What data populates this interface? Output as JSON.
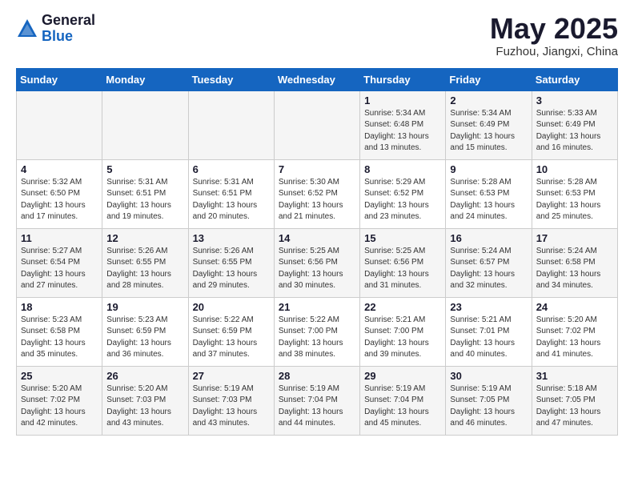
{
  "logo": {
    "general": "General",
    "blue": "Blue"
  },
  "title": {
    "month_year": "May 2025",
    "location": "Fuzhou, Jiangxi, China"
  },
  "weekdays": [
    "Sunday",
    "Monday",
    "Tuesday",
    "Wednesday",
    "Thursday",
    "Friday",
    "Saturday"
  ],
  "weeks": [
    [
      {
        "day": "",
        "info": ""
      },
      {
        "day": "",
        "info": ""
      },
      {
        "day": "",
        "info": ""
      },
      {
        "day": "",
        "info": ""
      },
      {
        "day": "1",
        "info": "Sunrise: 5:34 AM\nSunset: 6:48 PM\nDaylight: 13 hours\nand 13 minutes."
      },
      {
        "day": "2",
        "info": "Sunrise: 5:34 AM\nSunset: 6:49 PM\nDaylight: 13 hours\nand 15 minutes."
      },
      {
        "day": "3",
        "info": "Sunrise: 5:33 AM\nSunset: 6:49 PM\nDaylight: 13 hours\nand 16 minutes."
      }
    ],
    [
      {
        "day": "4",
        "info": "Sunrise: 5:32 AM\nSunset: 6:50 PM\nDaylight: 13 hours\nand 17 minutes."
      },
      {
        "day": "5",
        "info": "Sunrise: 5:31 AM\nSunset: 6:51 PM\nDaylight: 13 hours\nand 19 minutes."
      },
      {
        "day": "6",
        "info": "Sunrise: 5:31 AM\nSunset: 6:51 PM\nDaylight: 13 hours\nand 20 minutes."
      },
      {
        "day": "7",
        "info": "Sunrise: 5:30 AM\nSunset: 6:52 PM\nDaylight: 13 hours\nand 21 minutes."
      },
      {
        "day": "8",
        "info": "Sunrise: 5:29 AM\nSunset: 6:52 PM\nDaylight: 13 hours\nand 23 minutes."
      },
      {
        "day": "9",
        "info": "Sunrise: 5:28 AM\nSunset: 6:53 PM\nDaylight: 13 hours\nand 24 minutes."
      },
      {
        "day": "10",
        "info": "Sunrise: 5:28 AM\nSunset: 6:53 PM\nDaylight: 13 hours\nand 25 minutes."
      }
    ],
    [
      {
        "day": "11",
        "info": "Sunrise: 5:27 AM\nSunset: 6:54 PM\nDaylight: 13 hours\nand 27 minutes."
      },
      {
        "day": "12",
        "info": "Sunrise: 5:26 AM\nSunset: 6:55 PM\nDaylight: 13 hours\nand 28 minutes."
      },
      {
        "day": "13",
        "info": "Sunrise: 5:26 AM\nSunset: 6:55 PM\nDaylight: 13 hours\nand 29 minutes."
      },
      {
        "day": "14",
        "info": "Sunrise: 5:25 AM\nSunset: 6:56 PM\nDaylight: 13 hours\nand 30 minutes."
      },
      {
        "day": "15",
        "info": "Sunrise: 5:25 AM\nSunset: 6:56 PM\nDaylight: 13 hours\nand 31 minutes."
      },
      {
        "day": "16",
        "info": "Sunrise: 5:24 AM\nSunset: 6:57 PM\nDaylight: 13 hours\nand 32 minutes."
      },
      {
        "day": "17",
        "info": "Sunrise: 5:24 AM\nSunset: 6:58 PM\nDaylight: 13 hours\nand 34 minutes."
      }
    ],
    [
      {
        "day": "18",
        "info": "Sunrise: 5:23 AM\nSunset: 6:58 PM\nDaylight: 13 hours\nand 35 minutes."
      },
      {
        "day": "19",
        "info": "Sunrise: 5:23 AM\nSunset: 6:59 PM\nDaylight: 13 hours\nand 36 minutes."
      },
      {
        "day": "20",
        "info": "Sunrise: 5:22 AM\nSunset: 6:59 PM\nDaylight: 13 hours\nand 37 minutes."
      },
      {
        "day": "21",
        "info": "Sunrise: 5:22 AM\nSunset: 7:00 PM\nDaylight: 13 hours\nand 38 minutes."
      },
      {
        "day": "22",
        "info": "Sunrise: 5:21 AM\nSunset: 7:00 PM\nDaylight: 13 hours\nand 39 minutes."
      },
      {
        "day": "23",
        "info": "Sunrise: 5:21 AM\nSunset: 7:01 PM\nDaylight: 13 hours\nand 40 minutes."
      },
      {
        "day": "24",
        "info": "Sunrise: 5:20 AM\nSunset: 7:02 PM\nDaylight: 13 hours\nand 41 minutes."
      }
    ],
    [
      {
        "day": "25",
        "info": "Sunrise: 5:20 AM\nSunset: 7:02 PM\nDaylight: 13 hours\nand 42 minutes."
      },
      {
        "day": "26",
        "info": "Sunrise: 5:20 AM\nSunset: 7:03 PM\nDaylight: 13 hours\nand 43 minutes."
      },
      {
        "day": "27",
        "info": "Sunrise: 5:19 AM\nSunset: 7:03 PM\nDaylight: 13 hours\nand 43 minutes."
      },
      {
        "day": "28",
        "info": "Sunrise: 5:19 AM\nSunset: 7:04 PM\nDaylight: 13 hours\nand 44 minutes."
      },
      {
        "day": "29",
        "info": "Sunrise: 5:19 AM\nSunset: 7:04 PM\nDaylight: 13 hours\nand 45 minutes."
      },
      {
        "day": "30",
        "info": "Sunrise: 5:19 AM\nSunset: 7:05 PM\nDaylight: 13 hours\nand 46 minutes."
      },
      {
        "day": "31",
        "info": "Sunrise: 5:18 AM\nSunset: 7:05 PM\nDaylight: 13 hours\nand 47 minutes."
      }
    ]
  ]
}
